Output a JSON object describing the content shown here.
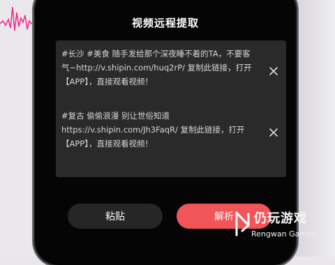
{
  "dialog": {
    "title": "视频远程提取"
  },
  "links": [
    {
      "text": "#长沙 #美食 随手发给那个深夜睡不着的TA，不要客气~http://v.shipin.com/huq2rP/ 复制此链接，打开【APP】，直接观看视频！"
    },
    {
      "text": "#复古 偷偷浪漫 别让世俗知道 https://v.shipin.com/Jh3FaqR/ 复制此链接，打开【APP】，直接观看视频！"
    }
  ],
  "buttons": {
    "paste": "粘贴",
    "parse": "解析"
  },
  "watermark": {
    "name_cn": "仍玩游戏",
    "name_en": "Rengwan Games"
  },
  "colors": {
    "accent": "#f25559",
    "panel": "#2a2a2a",
    "background": "#050505",
    "wave": "#f0308a"
  }
}
